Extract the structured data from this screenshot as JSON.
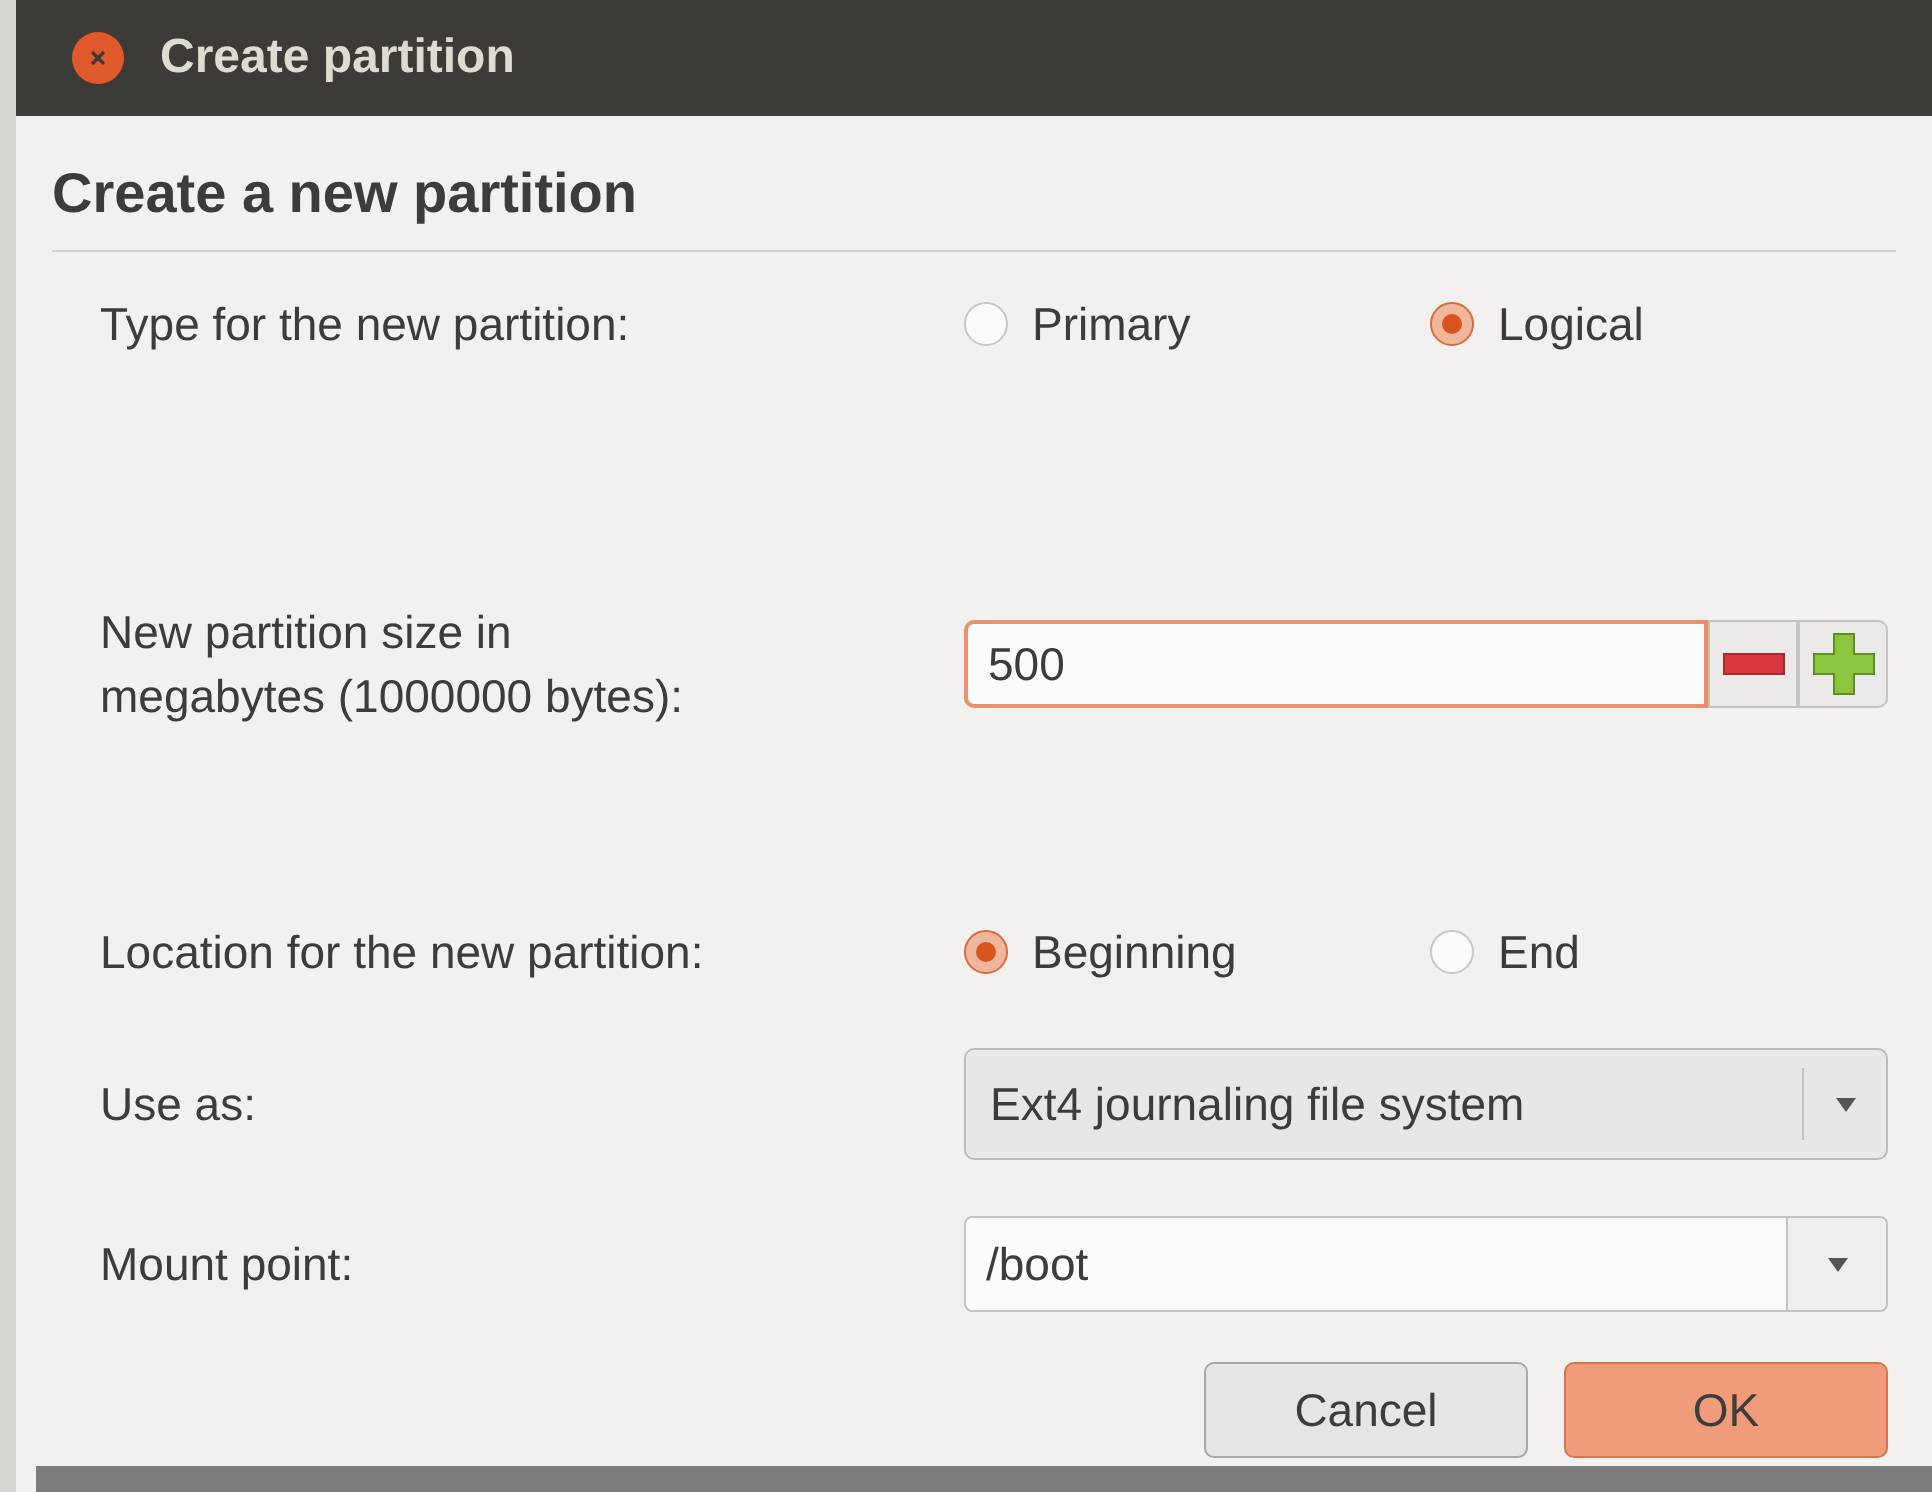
{
  "window": {
    "title": "Create partition"
  },
  "heading": "Create a new partition",
  "type": {
    "label": "Type for the new partition:",
    "options": [
      {
        "label": "Primary",
        "selected": false
      },
      {
        "label": "Logical",
        "selected": true
      }
    ]
  },
  "size": {
    "label": "New partition size in\nmegabytes (1000000 bytes):",
    "value": "500"
  },
  "location": {
    "label": "Location for the new partition:",
    "options": [
      {
        "label": "Beginning",
        "selected": true
      },
      {
        "label": "End",
        "selected": false
      }
    ]
  },
  "use_as": {
    "label": "Use as:",
    "value": "Ext4 journaling file system"
  },
  "mount_point": {
    "label": "Mount point:",
    "value": "/boot"
  },
  "buttons": [
    {
      "label": "Cancel",
      "kind": "cancel"
    },
    {
      "label": "OK",
      "kind": "default"
    }
  ]
}
